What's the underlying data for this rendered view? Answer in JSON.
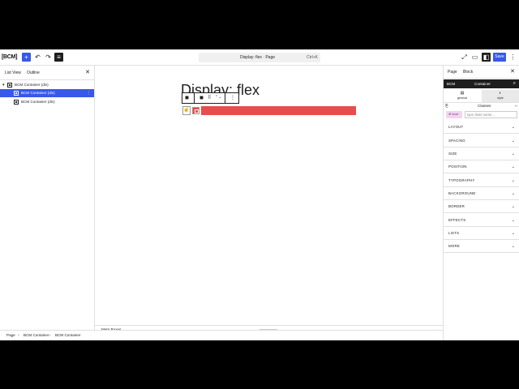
{
  "topbar": {
    "logo": "[BCM]",
    "add_icon": "+",
    "undo_icon": "↶",
    "redo_icon": "↷",
    "list_view_icon": "≡",
    "command": {
      "title": "Display: flex · Page",
      "shortcut": "Ctrl+K"
    },
    "view_icon": "⤢",
    "preview_icon": "▭",
    "settings_icon": "◧",
    "save_label": "Save",
    "more_icon": "⋮"
  },
  "left_panel": {
    "tabs": [
      "List View",
      "Outline"
    ],
    "close_icon": "✕",
    "tree": [
      {
        "label": "BCM Container (div)",
        "caret": "▾",
        "selected": false
      },
      {
        "label": "BCM Container (div)",
        "selected": true,
        "options_icon": "⋮"
      },
      {
        "label": "BCM Container (div)",
        "selected": false
      }
    ]
  },
  "canvas": {
    "heading": "Display: flex",
    "toolbar": {
      "block_icon": "◼",
      "drag_icon": "⠿",
      "mover_icon": "⌃⌄",
      "more_icon": "⋮"
    },
    "hand_icon": "☝"
  },
  "meta_boxes": {
    "label": "Meta Boxes",
    "chevron": "⌄"
  },
  "right_panel": {
    "tabs": [
      "Page",
      "Block"
    ],
    "close_icon": "✕",
    "header": {
      "left": "BCM",
      "title": "Container",
      "search_icon": "⌕"
    },
    "gs_tabs": [
      {
        "icon": "▤",
        "label": "general"
      },
      {
        "icon": "◐",
        "label": "style"
      }
    ],
    "classes": {
      "icon": "⎘",
      "label": "Classes",
      "toggle_icon": "‹›"
    },
    "local_tag": "⊗ local",
    "class_input_placeholder": "type class name...",
    "sections": [
      "LAYOUT",
      "SPACING",
      "SIZE",
      "POSITION",
      "TYPOGRAPHY",
      "BACKGROUND",
      "BORDER",
      "EFFECTS",
      "LISTS",
      "MORE"
    ],
    "section_chevron": "⌄"
  },
  "footer": {
    "breadcrumbs": [
      "Page",
      "BCM Container",
      "BCM Container"
    ],
    "separator": "›"
  },
  "colors": {
    "accent": "#3858e9",
    "red_block": "#e84d4d",
    "dark": "#1e1e1e",
    "local_tag_bg": "#f0d6ef"
  }
}
